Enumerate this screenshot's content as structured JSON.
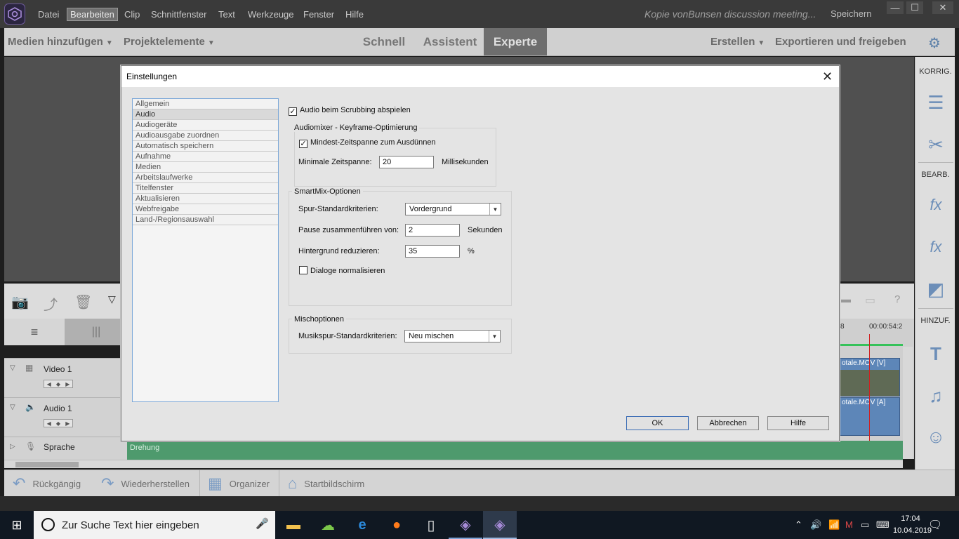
{
  "menu": {
    "items": [
      "Datei",
      "Bearbeiten",
      "Clip",
      "Schnittfenster",
      "Text",
      "Werkzeuge",
      "Fenster",
      "Hilfe"
    ],
    "active": "Bearbeiten",
    "doc_title": "Kopie vonBunsen discussion meeting...",
    "save": "Speichern",
    "window_controls": [
      "—",
      "☐",
      "✕"
    ]
  },
  "modebar": {
    "add_media": "Medien hinzufügen",
    "project_elements": "Projektelemente",
    "tabs": [
      "Schnell",
      "Assistent",
      "Experte"
    ],
    "active_tab": "Experte",
    "create": "Erstellen",
    "export": "Exportieren und freigeben"
  },
  "right_panel": {
    "korrig": "KORRIG.",
    "bearb": "BEARB.",
    "hinzuf": "HINZUF."
  },
  "timeline": {
    "tracks": [
      {
        "name": "Video 1"
      },
      {
        "name": "Audio 1"
      },
      {
        "name": "Sprache"
      }
    ],
    "timecode": "00:00:54:2",
    "partial_number": "8",
    "clip_video": "otale.MOV [V]",
    "clip_audio": "otale.MOV [A]",
    "sprache_clip": "Drehung"
  },
  "bottombar": {
    "undo": "Rückgängig",
    "redo": "Wiederherstellen",
    "organizer": "Organizer",
    "home": "Startbildschirm"
  },
  "dialog": {
    "title": "Einstellungen",
    "categories": [
      "Allgemein",
      "Audio",
      "Audiogeräte",
      "Audioausgabe zuordnen",
      "Automatisch speichern",
      "Aufnahme",
      "Medien",
      "Arbeitslaufwerke",
      "Titelfenster",
      "Aktualisieren",
      "Webfreigabe",
      "Land-/Regionsauswahl"
    ],
    "selected_category": "Audio",
    "scrub_audio": {
      "label": "Audio beim Scrubbing abspielen",
      "checked": true
    },
    "audiomixer": {
      "title": "Audiomixer - Keyframe-Optimierung",
      "thin_label": "Mindest-Zeitspanne zum Ausdünnen",
      "thin_checked": true,
      "min_span_label": "Minimale Zeitspanne:",
      "min_span_value": "20",
      "unit": "Millisekunden"
    },
    "smartmix": {
      "title": "SmartMix-Optionen",
      "criteria_label": "Spur-Standardkriterien:",
      "criteria_value": "Vordergrund",
      "pause_label": "Pause zusammenführen von:",
      "pause_value": "2",
      "pause_unit": "Sekunden",
      "reduce_label": "Hintergrund reduzieren:",
      "reduce_value": "35",
      "reduce_unit": "%",
      "normalize_label": "Dialoge normalisieren",
      "normalize_checked": false
    },
    "mix": {
      "title": "Mischoptionen",
      "music_label": "Musikspur-Standardkriterien:",
      "music_value": "Neu mischen"
    },
    "buttons": {
      "ok": "OK",
      "cancel": "Abbrechen",
      "help": "Hilfe"
    }
  },
  "taskbar": {
    "search_placeholder": "Zur Suche Text hier eingeben",
    "time": "17:04",
    "date": "10.04.2019"
  },
  "colors": {
    "accent": "#7aa7d8",
    "app_accent": "#6c8eb8",
    "sprache_track": "#4e9a6d",
    "playhead": "#d21f1f"
  }
}
